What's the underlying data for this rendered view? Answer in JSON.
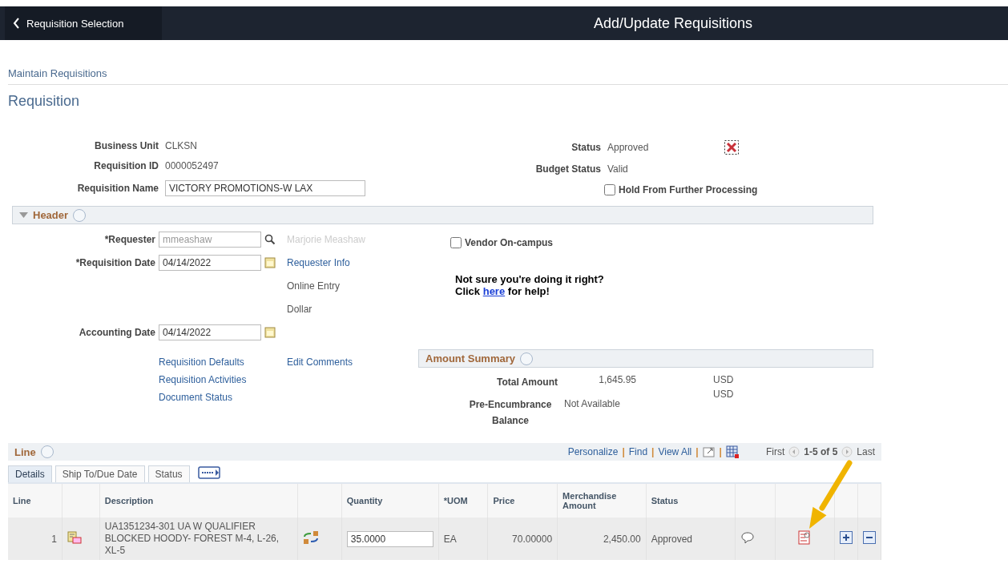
{
  "topbar": {
    "back_label": "Requisition Selection",
    "title": "Add/Update Requisitions"
  },
  "breadcrumb": "Maintain Requisitions",
  "page_title": "Requisition",
  "summary_left": [
    {
      "label": "Business Unit",
      "value": "CLKSN",
      "kind": "text"
    },
    {
      "label": "Requisition ID",
      "value": "0000052497",
      "kind": "text"
    },
    {
      "label": "Requisition Name",
      "value": "VICTORY PROMOTIONS-W LAX",
      "kind": "input"
    }
  ],
  "summary_right": [
    {
      "label": "Status",
      "value": "Approved"
    },
    {
      "label": "Budget Status",
      "value": "Valid"
    }
  ],
  "hold": {
    "label": "Hold From Further Processing",
    "checked": false
  },
  "header_section": {
    "title": "Header",
    "expanded": true
  },
  "requester": {
    "label": "*Requester",
    "value": "mmeashaw",
    "name": "Marjorie Meashaw"
  },
  "requisition_date": {
    "label": "*Requisition Date",
    "value": "04/14/2022"
  },
  "requester_info": "Requester Info",
  "origin": "Online Entry",
  "currency": "Dollar",
  "accounting_date": {
    "label": "Accounting Date",
    "value": "04/14/2022"
  },
  "links": [
    "Requisition Defaults",
    "Requisition Activities",
    "Document Status"
  ],
  "edit_comments": "Edit Comments",
  "vendor": {
    "label": "Vendor On-campus",
    "checked": false
  },
  "help": {
    "line1": "Not sure you're doing it right?",
    "before": "Click",
    "link": "here",
    "after": "for help!"
  },
  "amount_summary": {
    "title": "Amount Summary",
    "rows": [
      {
        "label": "Total Amount",
        "value": "1,645.95",
        "currency": "USD"
      },
      {
        "label": "Pre-Encumbrance Balance",
        "value": "Not Available",
        "currency": "USD"
      }
    ]
  },
  "line_grid": {
    "title": "Line",
    "nav_items": [
      {
        "kind": "link",
        "text": "Personalize"
      },
      {
        "kind": "separator",
        "text": "|"
      },
      {
        "kind": "link",
        "text": "Find"
      },
      {
        "kind": "separator",
        "text": "|"
      },
      {
        "kind": "link",
        "text": "View All"
      },
      {
        "kind": "separator",
        "text": "|"
      },
      {
        "kind": "zoom"
      },
      {
        "kind": "separator",
        "text": "|"
      },
      {
        "kind": "spreadsheet"
      }
    ],
    "first": "First",
    "range": "1-5 of 5",
    "last": "Last",
    "tabs": [
      {
        "label": "Details",
        "selected": true
      },
      {
        "label": "Ship To/Due Date",
        "selected": false
      },
      {
        "label": "Status",
        "selected": false
      }
    ],
    "columns": [
      "Line",
      "",
      "Description",
      "",
      "Quantity",
      "*UOM",
      "Price",
      "Merchandise Amount",
      "Status"
    ],
    "rows": [
      {
        "line": "1",
        "description": "UA1351234-301 UA W QUALIFIER BLOCKED HOODY- FOREST M-4, L-26, XL-5",
        "quantity": "35.0000",
        "uom": "EA",
        "price": "70.00000",
        "amount": "2,450.00",
        "status": "Approved"
      }
    ]
  }
}
